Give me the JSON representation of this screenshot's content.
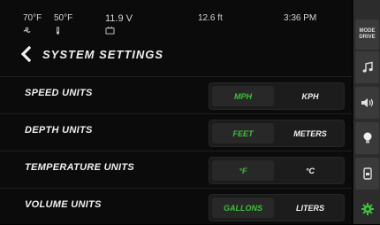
{
  "status": {
    "water_temp": "70°F",
    "air_temp": "50°F",
    "battery": "11.9 V",
    "depth": "12.6 ft",
    "time": "3:36 PM"
  },
  "header": {
    "title": "SYSTEM SETTINGS"
  },
  "settings": [
    {
      "label": "SPEED UNITS",
      "options": [
        "MPH",
        "KPH"
      ],
      "selected": "MPH"
    },
    {
      "label": "DEPTH UNITS",
      "options": [
        "FEET",
        "METERS"
      ],
      "selected": "FEET"
    },
    {
      "label": "TEMPERATURE UNITS",
      "options": [
        "°F",
        "°C"
      ],
      "selected": "°F"
    },
    {
      "label": "VOLUME UNITS",
      "options": [
        "GALLONS",
        "LITERS"
      ],
      "selected": "GALLONS"
    }
  ],
  "side_nav": {
    "mode_line1": "MODE",
    "mode_line2": "DRIVE",
    "icons": [
      "music-icon",
      "volume-icon",
      "light-icon",
      "engine-icon",
      "gear-icon"
    ]
  },
  "colors": {
    "active_text": "#3fbf3a",
    "background": "#0b0b0b",
    "side_panel": "#2c2c2c"
  }
}
